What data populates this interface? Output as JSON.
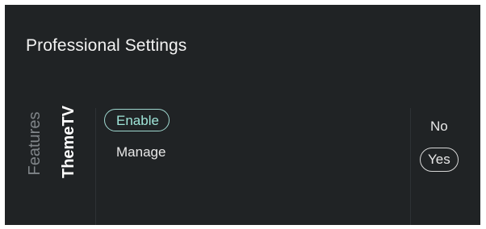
{
  "header": {
    "title": "Professional Settings"
  },
  "side_tabs": {
    "features": "Features",
    "themetv": "ThemeTV"
  },
  "menu": {
    "items": [
      {
        "label": "Enable",
        "focused": true
      },
      {
        "label": "Manage",
        "focused": false
      }
    ]
  },
  "options": {
    "items": [
      {
        "label": "No",
        "selected": false
      },
      {
        "label": "Yes",
        "selected": true
      }
    ]
  },
  "colors": {
    "background": "#202325",
    "focus_accent": "#9fe4d8",
    "text": "#e8e8e8",
    "muted_text": "#808589"
  }
}
